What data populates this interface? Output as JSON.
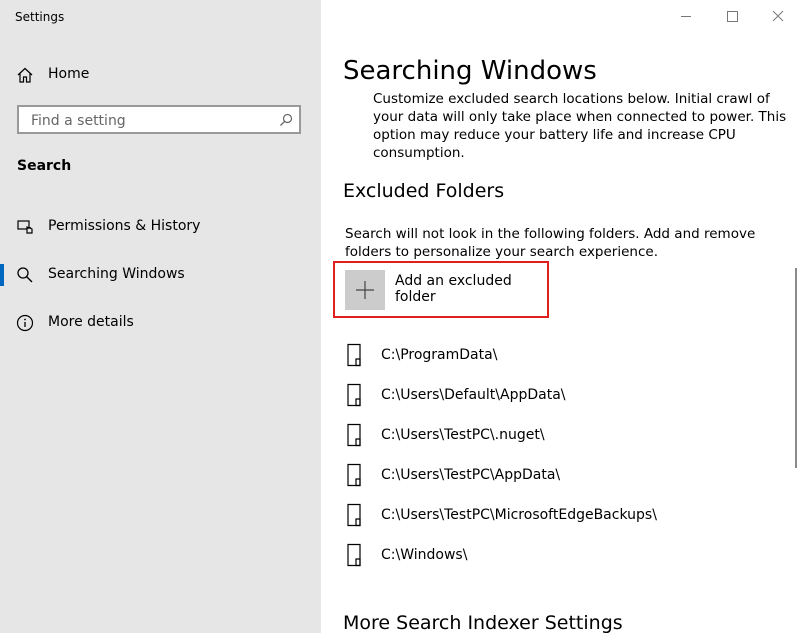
{
  "window": {
    "title": "Settings",
    "controls": {
      "minimize_icon": "minimize-icon",
      "maximize_icon": "maximize-icon",
      "close_icon": "close-icon"
    }
  },
  "sidebar": {
    "home": {
      "label": "Home",
      "icon": "home-icon"
    },
    "search": {
      "placeholder": "Find a setting",
      "icon": "search-icon"
    },
    "section_heading": "Search",
    "items": [
      {
        "label": "Permissions & History",
        "icon": "permissions-icon",
        "selected": false
      },
      {
        "label": "Searching Windows",
        "icon": "search-icon",
        "selected": true
      },
      {
        "label": "More details",
        "icon": "info-icon",
        "selected": false
      }
    ],
    "accent_color": "#0067c0"
  },
  "main": {
    "title": "Searching Windows",
    "description": "Customize excluded search locations below. Initial crawl of your data will only take place when connected to power. This option may reduce your battery life and increase CPU consumption.",
    "excluded": {
      "heading": "Excluded Folders",
      "explanation": "Search will not look in the following folders. Add and remove folders to personalize your search experience.",
      "add_button_label": "Add an excluded folder",
      "folders": [
        "C:\\ProgramData\\",
        "C:\\Users\\Default\\AppData\\",
        "C:\\Users\\TestPC\\.nuget\\",
        "C:\\Users\\TestPC\\AppData\\",
        "C:\\Users\\TestPC\\MicrosoftEdgeBackups\\",
        "C:\\Windows\\"
      ]
    },
    "more_heading": "More Search Indexer Settings",
    "highlight_color": "#e0201f"
  }
}
